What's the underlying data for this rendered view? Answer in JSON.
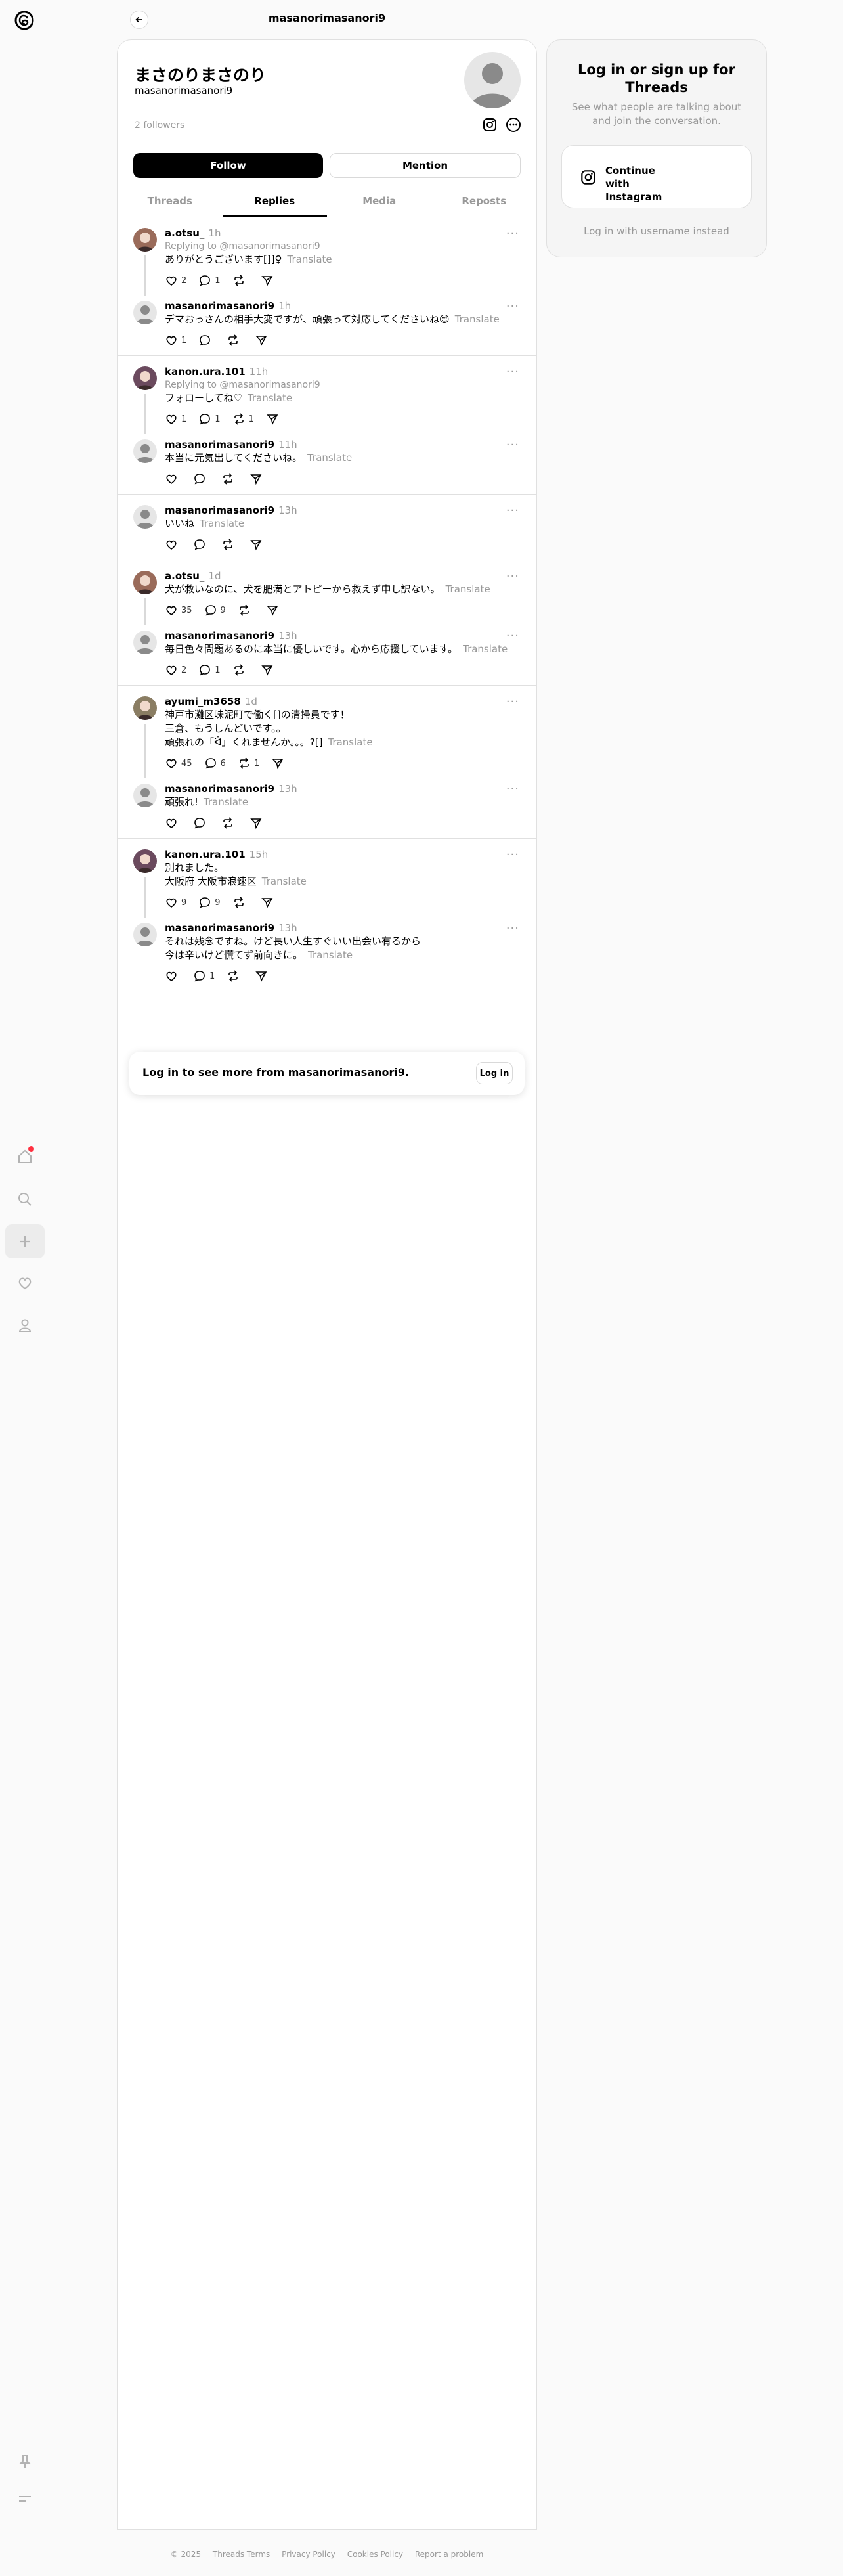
{
  "header": {
    "title": "masanorimasanori9"
  },
  "profile": {
    "display_name": "まさのりまさのり",
    "username": "masanorimasanori9",
    "followers": "2 followers",
    "follow_label": "Follow",
    "mention_label": "Mention"
  },
  "tabs": [
    "Threads",
    "Replies",
    "Media",
    "Reposts"
  ],
  "translate": "Translate",
  "feed": {
    "g0": {
      "p0": {
        "user": "a.otsu_",
        "time": "1h",
        "reply_to": "Replying to @masanorimasanori9",
        "text": "ありがとうございます[]]♀",
        "likes": "2",
        "comments": "1",
        "reposts": ""
      },
      "p1": {
        "user": "masanorimasanori9",
        "time": "1h",
        "text": "デマおっさんの相手大変ですが、頑張って対応してくださいね😊",
        "likes": "1",
        "comments": "",
        "reposts": ""
      }
    },
    "g1": {
      "p0": {
        "user": "kanon.ura.101",
        "time": "11h",
        "reply_to": "Replying to @masanorimasanori9",
        "text": "フォローしてね♡",
        "likes": "1",
        "comments": "1",
        "reposts": "1"
      },
      "p1": {
        "user": "masanorimasanori9",
        "time": "11h",
        "text": "本当に元気出してくださいね。",
        "likes": "",
        "comments": "",
        "reposts": ""
      }
    },
    "g2": {
      "p0": {
        "user": "masanorimasanori9",
        "time": "13h",
        "text": "いいね",
        "likes": "",
        "comments": "",
        "reposts": ""
      }
    },
    "g3": {
      "p0": {
        "user": "a.otsu_",
        "time": "1d",
        "text": "犬が救いなのに、犬を肥満とアトピーから救えず申し訳ない。",
        "likes": "35",
        "comments": "9",
        "reposts": ""
      },
      "p1": {
        "user": "masanorimasanori9",
        "time": "13h",
        "text": "毎日色々問題あるのに本当に優しいです。心から応援しています。",
        "likes": "2",
        "comments": "1",
        "reposts": ""
      }
    },
    "g4": {
      "p0": {
        "user": "ayumi_m3658",
        "time": "1d",
        "text": "神戸市灘区味泥町で働く[]の清掃員です！\n三倉、もうしんどいです。。\n頑張れの「ᐛ」くれませんか。。。?[]",
        "likes": "45",
        "comments": "6",
        "reposts": "1"
      },
      "p1": {
        "user": "masanorimasanori9",
        "time": "13h",
        "text": "頑張れ!",
        "likes": "",
        "comments": "",
        "reposts": ""
      }
    },
    "g5": {
      "p0": {
        "user": "kanon.ura.101",
        "time": "15h",
        "text": "別れました。\n大阪府 大阪市浪速区",
        "likes": "9",
        "comments": "9",
        "reposts": ""
      },
      "p1": {
        "user": "masanorimasanori9",
        "time": "13h",
        "text": "それは残念ですね。けど長い人生すぐいい出会い有るから\n今は辛いけど慌てず前向きに。",
        "likes": "",
        "comments": "1",
        "reposts": ""
      }
    }
  },
  "login_prompt": {
    "text": "Log in to see more from masanorimasanori9.",
    "button": "Log in"
  },
  "side": {
    "title": "Log in or sign up for Threads",
    "subtitle": "See what people are talking about and join the conversation.",
    "instagram_button": "Continue with Instagram",
    "username_link": "Log in with username instead"
  },
  "footer": [
    "© 2025",
    "Threads Terms",
    "Privacy Policy",
    "Cookies Policy",
    "Report a problem"
  ],
  "colors": {
    "accent": "#000000",
    "notification": "#ff3040",
    "muted": "#999999"
  }
}
